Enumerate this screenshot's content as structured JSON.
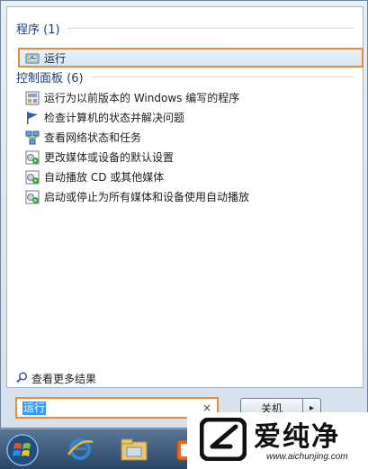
{
  "programs": {
    "header": "程序 (1)",
    "items": [
      {
        "label": "运行",
        "icon": "run-icon"
      }
    ]
  },
  "control_panel": {
    "header": "控制面板 (6)",
    "items": [
      {
        "label": "运行为以前版本的 Windows 编写的程序",
        "icon": "compatibility-icon"
      },
      {
        "label": "检查计算机的状态并解决问题",
        "icon": "action-center-flag-icon"
      },
      {
        "label": "查看网络状态和任务",
        "icon": "network-icon"
      },
      {
        "label": "更改媒体或设备的默认设置",
        "icon": "autoplay-icon"
      },
      {
        "label": "自动播放 CD 或其他媒体",
        "icon": "autoplay-icon"
      },
      {
        "label": "启动或停止为所有媒体和设备使用自动播放",
        "icon": "autoplay-icon"
      }
    ]
  },
  "search_more": "查看更多结果",
  "search": {
    "value": "运行",
    "clear": "×"
  },
  "shutdown": {
    "label": "关机",
    "arrow": "▸"
  },
  "watermark": {
    "brand": "爱纯净",
    "url": "www.aichunjing.com"
  },
  "colors": {
    "highlight_border": "#ee8a33",
    "header_text": "#1e3d7a",
    "selection": "#3399ff"
  }
}
